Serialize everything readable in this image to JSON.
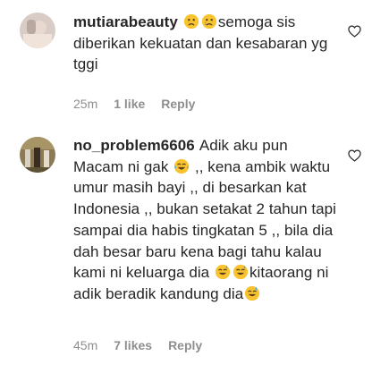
{
  "comments": [
    {
      "username": "mutiarabeauty",
      "text_parts": [
        "semoga sis diberikan kekuatan dan kesabaran yg tggi"
      ],
      "emojis": [
        "sad-face-emoji",
        "crying-face-emoji"
      ],
      "time": "25m",
      "likes": "1 like",
      "reply": "Reply"
    },
    {
      "username": "no_problem6606",
      "text_parts": [
        "Adik aku pun Macam ni gak",
        ",, kena ambik waktu umur masih bayi ,, di besarkan kat Indonesia ,, bukan setakat 2 tahun tapi sampai dia habis tingkatan 5 ,, bila dia dah besar baru kena bagi tahu kalau kami ni keluarga dia",
        "kitaorang ni adik beradik kandung dia"
      ],
      "emojis": [
        "tears-of-joy-emoji",
        "sweat-smile-emoji",
        "sweat-smile-emoji",
        "sweat-smile-emoji"
      ],
      "time": "45m",
      "likes": "7 likes",
      "reply": "Reply"
    }
  ],
  "icons": {
    "like": "heart-outline-icon"
  },
  "colors": {
    "text": "#262626",
    "meta": "#8e8e8e",
    "emoji": "#f7c32e"
  }
}
